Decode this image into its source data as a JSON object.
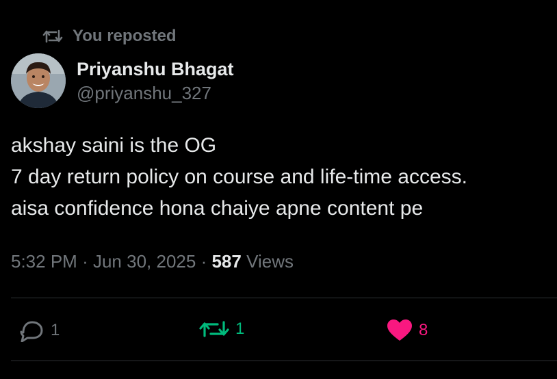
{
  "repost_banner": {
    "icon": "repost-icon",
    "text": "You reposted"
  },
  "author": {
    "avatar": "avatar",
    "display_name": "Priyanshu Bhagat",
    "handle": "@priyanshu_327"
  },
  "tweet": {
    "lines": [
      "akshay saini is the OG",
      "7 day return policy on course and life-time access.",
      "aisa confidence hona chaiye apne content pe"
    ]
  },
  "meta": {
    "time": "5:32 PM",
    "separator": "·",
    "date": "Jun 30, 2025",
    "views_count": "587",
    "views_label": "Views"
  },
  "actions": {
    "reply": {
      "icon": "reply-icon",
      "count": "1"
    },
    "repost": {
      "icon": "repost-icon",
      "count": "1",
      "color": "#00ba7c"
    },
    "like": {
      "icon": "heart-icon",
      "count": "8",
      "color": "#f91880"
    }
  },
  "colors": {
    "background": "#000000",
    "text": "#e7e9ea",
    "muted": "#71767b",
    "divider": "#2f3336"
  }
}
